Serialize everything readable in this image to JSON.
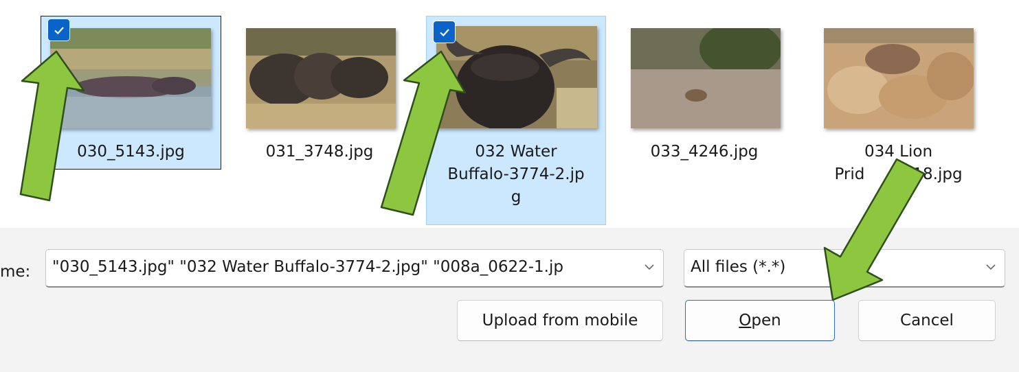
{
  "files": [
    {
      "name": "030_5143.jpg",
      "selected": true,
      "checked": true,
      "focused": true
    },
    {
      "name": "031_3748.jpg",
      "selected": false,
      "checked": false,
      "focused": false
    },
    {
      "name": "032 Water Buffalo-3774-2.jpg",
      "line1": "032 Water",
      "line2": "Buffalo-3774-2.jp",
      "line3": "g",
      "selected": true,
      "checked": true,
      "focused": false
    },
    {
      "name": "033_4246.jpg",
      "selected": false,
      "checked": false,
      "focused": false
    },
    {
      "name": "034 Lion Pride...18.jpg",
      "line1": "034 Lion",
      "line2_left": "Prid",
      "line2_right": "18.jpg",
      "selected": false,
      "checked": false,
      "focused": false
    }
  ],
  "cut_label": "...jpg",
  "filename": {
    "label": "me:",
    "value": "\"030_5143.jpg\" \"032 Water Buffalo-3774-2.jpg\" \"008a_0622-1.jp"
  },
  "filetype": {
    "value": "All files (*.*)"
  },
  "buttons": {
    "upload": "Upload from mobile",
    "open_mnemonic": "O",
    "open_rest": "pen",
    "cancel": "Cancel"
  },
  "colors": {
    "selection_bg": "#cce8ff",
    "selection_border": "#99d1ff",
    "checkbox": "#0a63c9",
    "arrow_fill": "#8dc63f",
    "arrow_stroke": "#2f4f1a",
    "bar_bg": "#f3f3f3"
  },
  "icons": [
    "check-icon",
    "chevron-down-icon",
    "annotation-arrow"
  ]
}
